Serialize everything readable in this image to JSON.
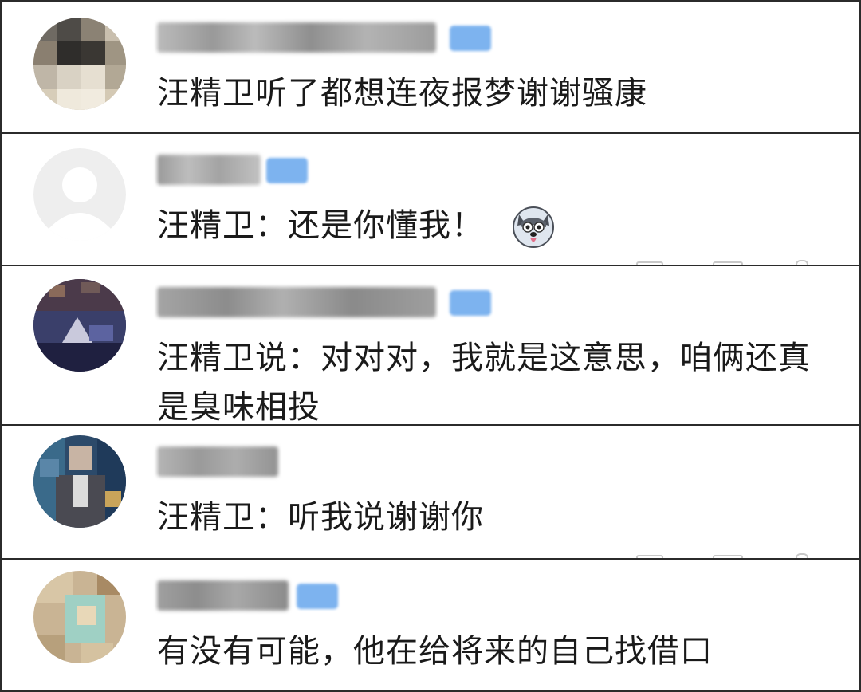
{
  "comments": [
    {
      "text": "汪精卫听了都想连夜报梦谢谢骚康"
    },
    {
      "text": "汪精卫：还是你懂我！"
    },
    {
      "text_line1": "汪精卫说：对对对，我就是这意思，咱俩还真",
      "text_line2": "是臭味相投"
    },
    {
      "text": "汪精卫：听我说谢谢你"
    },
    {
      "text": "有没有可能，他在给将来的自己找借口"
    }
  ],
  "colors": {
    "border": "#2b2b2b",
    "badge": "#7db3ef",
    "text": "#1a1a1a",
    "blurred_name": "#9a9a9a"
  },
  "icons": [
    "blurred-avatar",
    "default-avatar-icon",
    "husky-emoji-icon",
    "reply-icon",
    "share-icon",
    "like-icon"
  ]
}
